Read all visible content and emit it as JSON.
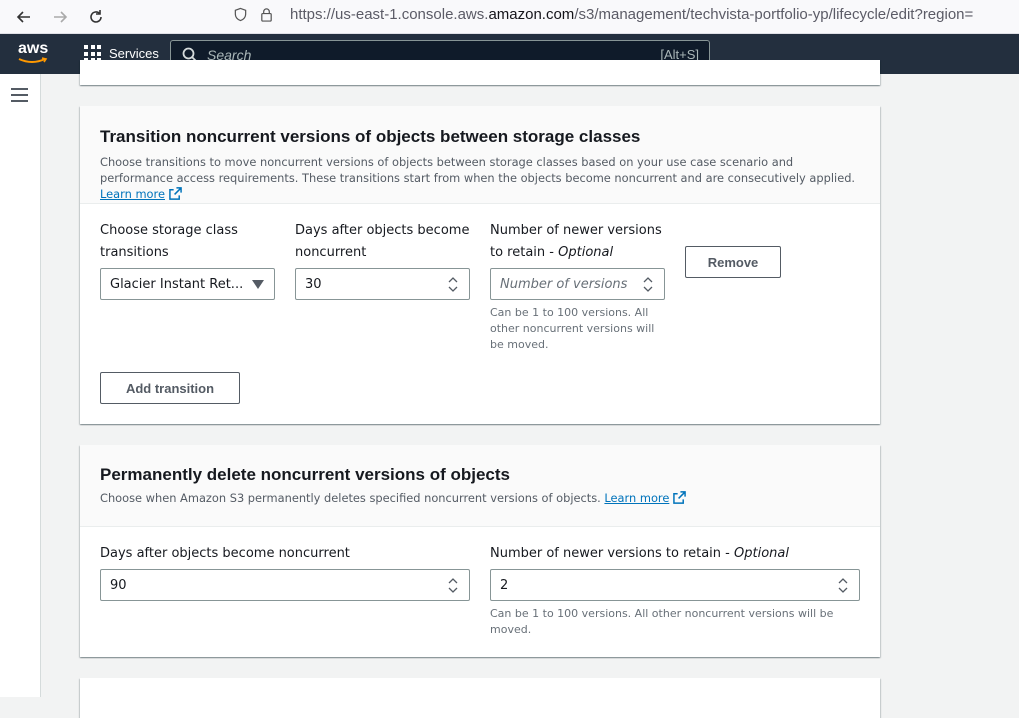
{
  "browser": {
    "url_prefix": "https://us-east-1.console.aws.",
    "url_domain": "amazon.com",
    "url_suffix": "/s3/management/techvista-portfolio-yp/lifecycle/edit?region="
  },
  "aws_nav": {
    "logo": "aws",
    "services_label": "Services",
    "search_placeholder": "Search",
    "search_hint": "[Alt+S]"
  },
  "transition_panel": {
    "title": "Transition noncurrent versions of objects between storage classes",
    "description": "Choose transitions to move noncurrent versions of objects between storage classes based on your use case scenario and performance access requirements. These transitions start from when the objects become noncurrent and are consecutively applied.",
    "learn_more": "Learn more",
    "storage_class_label_1": "Choose storage class",
    "storage_class_label_2": "transitions",
    "storage_class_value": "Glacier Instant Ret...",
    "days_label_1": "Days after objects become",
    "days_label_2": "noncurrent",
    "days_value": "30",
    "versions_label_1": "Number of newer versions",
    "versions_label_2": "to retain - ",
    "versions_label_optional": "Optional",
    "versions_placeholder": "Number of versions",
    "versions_hint_1": "Can be 1 to 100 versions. All",
    "versions_hint_2": "other noncurrent versions will",
    "versions_hint_3": "be moved.",
    "remove_button": "Remove",
    "add_transition_button": "Add transition"
  },
  "delete_panel": {
    "title": "Permanently delete noncurrent versions of objects",
    "description": "Choose when Amazon S3 permanently deletes specified noncurrent versions of objects.",
    "learn_more": "Learn more",
    "days_label": "Days after objects become noncurrent",
    "days_value": "90",
    "versions_label": "Number of newer versions to retain - ",
    "versions_label_optional": "Optional",
    "versions_value": "2",
    "versions_hint_1": "Can be 1 to 100 versions. All other noncurrent versions will be",
    "versions_hint_2": "moved."
  },
  "colors": {
    "aws_nav_bg": "#232f3e",
    "link": "#0073bb"
  }
}
